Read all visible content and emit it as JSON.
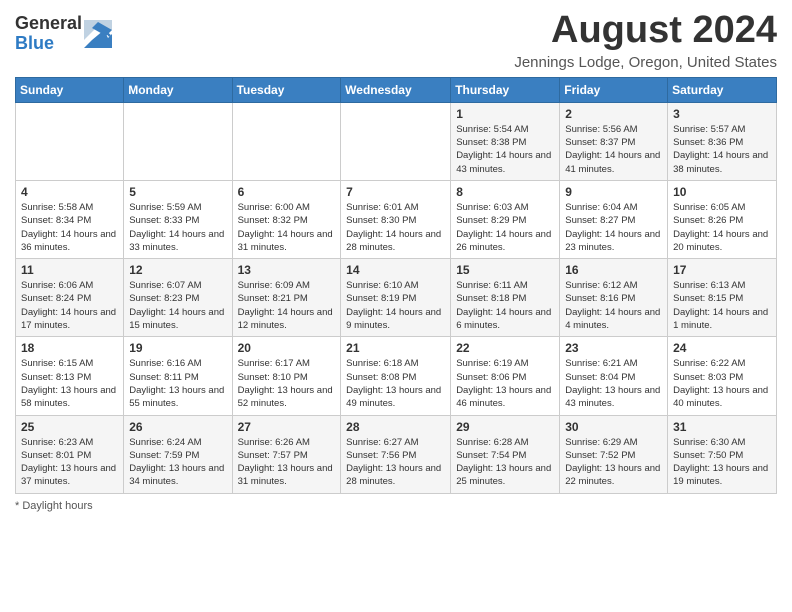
{
  "header": {
    "logo_general": "General",
    "logo_blue": "Blue",
    "main_title": "August 2024",
    "subtitle": "Jennings Lodge, Oregon, United States"
  },
  "calendar": {
    "days_of_week": [
      "Sunday",
      "Monday",
      "Tuesday",
      "Wednesday",
      "Thursday",
      "Friday",
      "Saturday"
    ],
    "weeks": [
      [
        {
          "day": "",
          "info": ""
        },
        {
          "day": "",
          "info": ""
        },
        {
          "day": "",
          "info": ""
        },
        {
          "day": "",
          "info": ""
        },
        {
          "day": "1",
          "info": "Sunrise: 5:54 AM\nSunset: 8:38 PM\nDaylight: 14 hours and 43 minutes."
        },
        {
          "day": "2",
          "info": "Sunrise: 5:56 AM\nSunset: 8:37 PM\nDaylight: 14 hours and 41 minutes."
        },
        {
          "day": "3",
          "info": "Sunrise: 5:57 AM\nSunset: 8:36 PM\nDaylight: 14 hours and 38 minutes."
        }
      ],
      [
        {
          "day": "4",
          "info": "Sunrise: 5:58 AM\nSunset: 8:34 PM\nDaylight: 14 hours and 36 minutes."
        },
        {
          "day": "5",
          "info": "Sunrise: 5:59 AM\nSunset: 8:33 PM\nDaylight: 14 hours and 33 minutes."
        },
        {
          "day": "6",
          "info": "Sunrise: 6:00 AM\nSunset: 8:32 PM\nDaylight: 14 hours and 31 minutes."
        },
        {
          "day": "7",
          "info": "Sunrise: 6:01 AM\nSunset: 8:30 PM\nDaylight: 14 hours and 28 minutes."
        },
        {
          "day": "8",
          "info": "Sunrise: 6:03 AM\nSunset: 8:29 PM\nDaylight: 14 hours and 26 minutes."
        },
        {
          "day": "9",
          "info": "Sunrise: 6:04 AM\nSunset: 8:27 PM\nDaylight: 14 hours and 23 minutes."
        },
        {
          "day": "10",
          "info": "Sunrise: 6:05 AM\nSunset: 8:26 PM\nDaylight: 14 hours and 20 minutes."
        }
      ],
      [
        {
          "day": "11",
          "info": "Sunrise: 6:06 AM\nSunset: 8:24 PM\nDaylight: 14 hours and 17 minutes."
        },
        {
          "day": "12",
          "info": "Sunrise: 6:07 AM\nSunset: 8:23 PM\nDaylight: 14 hours and 15 minutes."
        },
        {
          "day": "13",
          "info": "Sunrise: 6:09 AM\nSunset: 8:21 PM\nDaylight: 14 hours and 12 minutes."
        },
        {
          "day": "14",
          "info": "Sunrise: 6:10 AM\nSunset: 8:19 PM\nDaylight: 14 hours and 9 minutes."
        },
        {
          "day": "15",
          "info": "Sunrise: 6:11 AM\nSunset: 8:18 PM\nDaylight: 14 hours and 6 minutes."
        },
        {
          "day": "16",
          "info": "Sunrise: 6:12 AM\nSunset: 8:16 PM\nDaylight: 14 hours and 4 minutes."
        },
        {
          "day": "17",
          "info": "Sunrise: 6:13 AM\nSunset: 8:15 PM\nDaylight: 14 hours and 1 minute."
        }
      ],
      [
        {
          "day": "18",
          "info": "Sunrise: 6:15 AM\nSunset: 8:13 PM\nDaylight: 13 hours and 58 minutes."
        },
        {
          "day": "19",
          "info": "Sunrise: 6:16 AM\nSunset: 8:11 PM\nDaylight: 13 hours and 55 minutes."
        },
        {
          "day": "20",
          "info": "Sunrise: 6:17 AM\nSunset: 8:10 PM\nDaylight: 13 hours and 52 minutes."
        },
        {
          "day": "21",
          "info": "Sunrise: 6:18 AM\nSunset: 8:08 PM\nDaylight: 13 hours and 49 minutes."
        },
        {
          "day": "22",
          "info": "Sunrise: 6:19 AM\nSunset: 8:06 PM\nDaylight: 13 hours and 46 minutes."
        },
        {
          "day": "23",
          "info": "Sunrise: 6:21 AM\nSunset: 8:04 PM\nDaylight: 13 hours and 43 minutes."
        },
        {
          "day": "24",
          "info": "Sunrise: 6:22 AM\nSunset: 8:03 PM\nDaylight: 13 hours and 40 minutes."
        }
      ],
      [
        {
          "day": "25",
          "info": "Sunrise: 6:23 AM\nSunset: 8:01 PM\nDaylight: 13 hours and 37 minutes."
        },
        {
          "day": "26",
          "info": "Sunrise: 6:24 AM\nSunset: 7:59 PM\nDaylight: 13 hours and 34 minutes."
        },
        {
          "day": "27",
          "info": "Sunrise: 6:26 AM\nSunset: 7:57 PM\nDaylight: 13 hours and 31 minutes."
        },
        {
          "day": "28",
          "info": "Sunrise: 6:27 AM\nSunset: 7:56 PM\nDaylight: 13 hours and 28 minutes."
        },
        {
          "day": "29",
          "info": "Sunrise: 6:28 AM\nSunset: 7:54 PM\nDaylight: 13 hours and 25 minutes."
        },
        {
          "day": "30",
          "info": "Sunrise: 6:29 AM\nSunset: 7:52 PM\nDaylight: 13 hours and 22 minutes."
        },
        {
          "day": "31",
          "info": "Sunrise: 6:30 AM\nSunset: 7:50 PM\nDaylight: 13 hours and 19 minutes."
        }
      ]
    ]
  },
  "footer": {
    "note": "Daylight hours"
  }
}
